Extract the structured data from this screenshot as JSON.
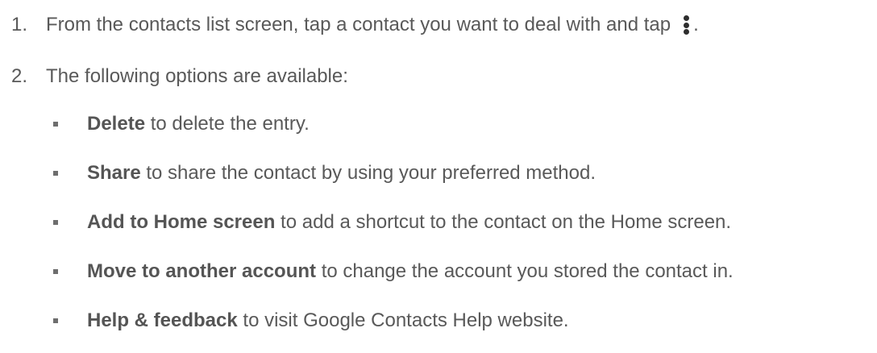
{
  "steps": [
    {
      "number": "1.",
      "text_before": "From the contacts list screen, tap a contact you want to deal with and tap",
      "icon": "more-vert-icon",
      "text_after": "."
    },
    {
      "number": "2.",
      "text": "The following options are available:"
    }
  ],
  "options": [
    {
      "term": "Delete",
      "description": " to delete the entry."
    },
    {
      "term": "Share",
      "description": " to share the contact by using your preferred method."
    },
    {
      "term": "Add to Home screen",
      "description": " to add a shortcut to the contact on the Home screen."
    },
    {
      "term": "Move to another account",
      "description": " to change the account you stored the contact in."
    },
    {
      "term": "Help & feedback",
      "description": " to visit Google Contacts Help website."
    }
  ]
}
